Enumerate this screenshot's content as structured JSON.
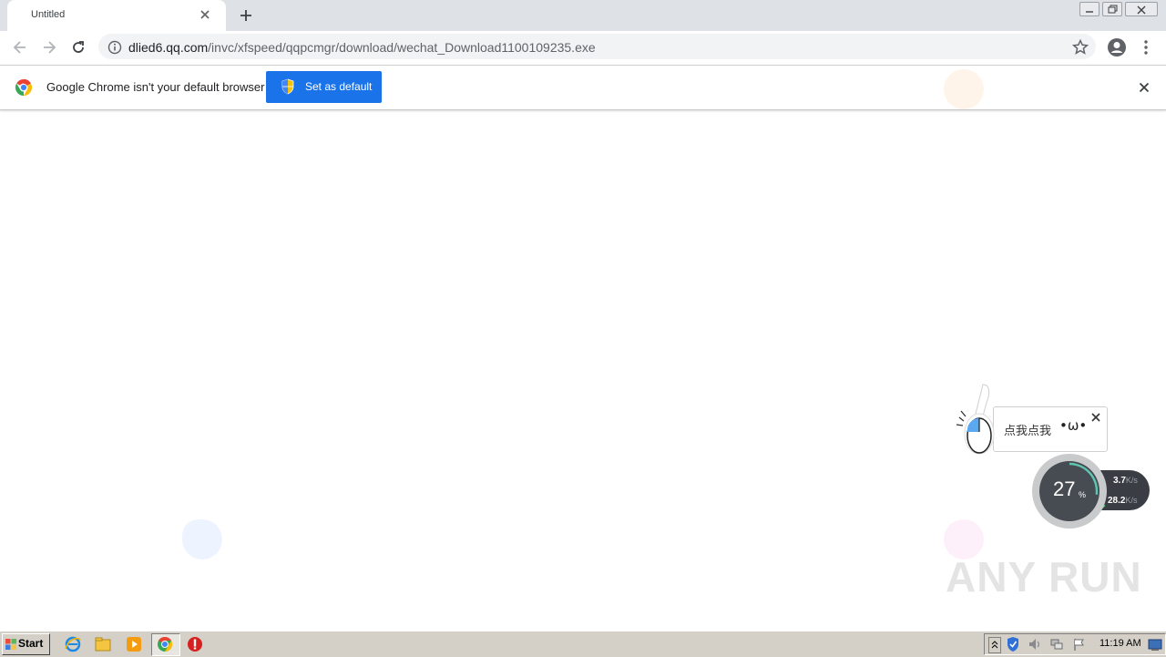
{
  "browser": {
    "tab_title": "Untitled",
    "url_host": "dlied6.qq.com",
    "url_path": "/invc/xfspeed/qqpcmgr/download/wechat_Download1100109235.exe"
  },
  "infobar": {
    "message": "Google Chrome isn't your default browser",
    "button_label": "Set as default"
  },
  "widget": {
    "bubble_text": "点我点我",
    "bubble_face": "•ω•",
    "percent": "27",
    "percent_sign": "%",
    "upload_speed": "3.7",
    "download_speed": "28.2",
    "speed_unit": "K/s",
    "progress_fraction": 0.27
  },
  "watermark": "ANY RUN",
  "taskbar": {
    "start_label": "Start",
    "clock": "11:19 AM"
  },
  "colors": {
    "accent": "#1a73e8",
    "tabstrip": "#dee1e6",
    "taskbar": "#d4d0c8"
  }
}
